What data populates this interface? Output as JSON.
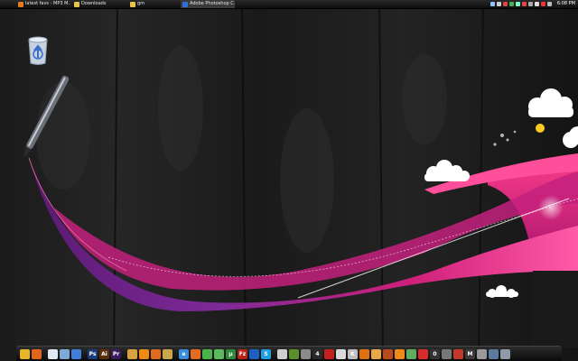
{
  "taskbar": {
    "tasks": [
      {
        "label": "latest favs - MP3 M...",
        "icon": "firefox-icon",
        "color": "#e07b22"
      },
      {
        "label": "Downloads",
        "icon": "folder-icon",
        "color": "#e8c44a"
      },
      {
        "label": "gm",
        "icon": "folder-icon",
        "color": "#e8c44a"
      },
      {
        "label": "Adobe Photoshop C...",
        "icon": "photoshop-icon",
        "color": "#2f6fd6"
      }
    ],
    "clock": "6:08 PM"
  },
  "tray_icons": [
    {
      "name": "network-icon",
      "color": "#8fc4ff"
    },
    {
      "name": "volume-icon",
      "color": "#cccccc"
    },
    {
      "name": "antivirus-icon",
      "color": "#d44"
    },
    {
      "name": "messenger-icon",
      "color": "#4caf50"
    },
    {
      "name": "update-icon",
      "color": "#7fc"
    },
    {
      "name": "shield-icon",
      "color": "#e44"
    },
    {
      "name": "battery-icon",
      "color": "#aaa"
    },
    {
      "name": "wifi-icon",
      "color": "#ddd"
    },
    {
      "name": "sync-icon",
      "color": "#e33"
    },
    {
      "name": "speaker-icon",
      "color": "#bbb"
    }
  ],
  "desktop": {
    "recycle_bin": {
      "icon": "recycle-bin-icon"
    }
  },
  "dock": {
    "items": [
      {
        "name": "finder-icon",
        "color": "#e8b52a",
        "glyph": ""
      },
      {
        "name": "firefox-icon",
        "color": "#e0661b",
        "glyph": ""
      },
      {
        "name": "sep"
      },
      {
        "name": "notes-icon",
        "color": "#dfe8f5",
        "glyph": ""
      },
      {
        "name": "folder-icon",
        "color": "#7fa9d9",
        "glyph": ""
      },
      {
        "name": "document-icon",
        "color": "#3f7fd8",
        "glyph": ""
      },
      {
        "name": "sep"
      },
      {
        "name": "photoshop-icon",
        "color": "#1a3d7a",
        "glyph": "Ps"
      },
      {
        "name": "illustrator-icon",
        "color": "#5a2d0c",
        "glyph": "Ai"
      },
      {
        "name": "premiere-icon",
        "color": "#3b1a5e",
        "glyph": "Pr"
      },
      {
        "name": "sep"
      },
      {
        "name": "paint-icon",
        "color": "#d9a040",
        "glyph": ""
      },
      {
        "name": "vlc-icon",
        "color": "#f08a12",
        "glyph": ""
      },
      {
        "name": "fruity-loops-icon",
        "color": "#e06b1a",
        "glyph": ""
      },
      {
        "name": "winamp-icon",
        "color": "#caa74a",
        "glyph": ""
      },
      {
        "name": "sep"
      },
      {
        "name": "internet-explorer-icon",
        "color": "#3a8fdc",
        "glyph": "e"
      },
      {
        "name": "firefox-alt-icon",
        "color": "#e56b20",
        "glyph": ""
      },
      {
        "name": "chat-icon",
        "color": "#49b249",
        "glyph": ""
      },
      {
        "name": "messenger-icon",
        "color": "#5cb85c",
        "glyph": ""
      },
      {
        "name": "utorrent-icon",
        "color": "#2d8a3b",
        "glyph": "µ"
      },
      {
        "name": "filezilla-icon",
        "color": "#b5231a",
        "glyph": "Fz"
      },
      {
        "name": "ftp-icon",
        "color": "#1f5fbf",
        "glyph": ""
      },
      {
        "name": "skype-icon",
        "color": "#1ea0e0",
        "glyph": "S"
      },
      {
        "name": "sep"
      },
      {
        "name": "steam-icon",
        "color": "#cfcfcf",
        "glyph": ""
      },
      {
        "name": "game-icon",
        "color": "#5a8f2b",
        "glyph": ""
      },
      {
        "name": "crosshair-icon",
        "color": "#8a8a8a",
        "glyph": ""
      },
      {
        "name": "four-icon",
        "color": "#2a2a2a",
        "glyph": "4"
      },
      {
        "name": "devil-icon",
        "color": "#c42020",
        "glyph": ""
      },
      {
        "name": "game-alt-icon",
        "color": "#d9d9d9",
        "glyph": ""
      },
      {
        "name": "counter-strike-icon",
        "color": "#bfbfbf",
        "glyph": "K"
      },
      {
        "name": "half-life-icon",
        "color": "#e07010",
        "glyph": ""
      },
      {
        "name": "portal-icon",
        "color": "#e8a84a",
        "glyph": ""
      },
      {
        "name": "team-fortress-icon",
        "color": "#b84a1e",
        "glyph": ""
      },
      {
        "name": "orange-box-icon",
        "color": "#ef8a1a",
        "glyph": ""
      },
      {
        "name": "map-icon",
        "color": "#5fae5f",
        "glyph": ""
      },
      {
        "name": "mario-icon",
        "color": "#d82b2b",
        "glyph": ""
      },
      {
        "name": "zero-icon",
        "color": "#333333",
        "glyph": "0"
      },
      {
        "name": "nuke-icon",
        "color": "#777777",
        "glyph": ""
      },
      {
        "name": "bug-icon",
        "color": "#c0392b",
        "glyph": ""
      },
      {
        "name": "m-icon",
        "color": "#3a3a3a",
        "glyph": "M"
      },
      {
        "name": "mech-icon",
        "color": "#9a9a9a",
        "glyph": ""
      },
      {
        "name": "ship-icon",
        "color": "#5a7aa0",
        "glyph": ""
      },
      {
        "name": "trash-icon",
        "color": "#8f9aa8",
        "glyph": ""
      }
    ]
  }
}
